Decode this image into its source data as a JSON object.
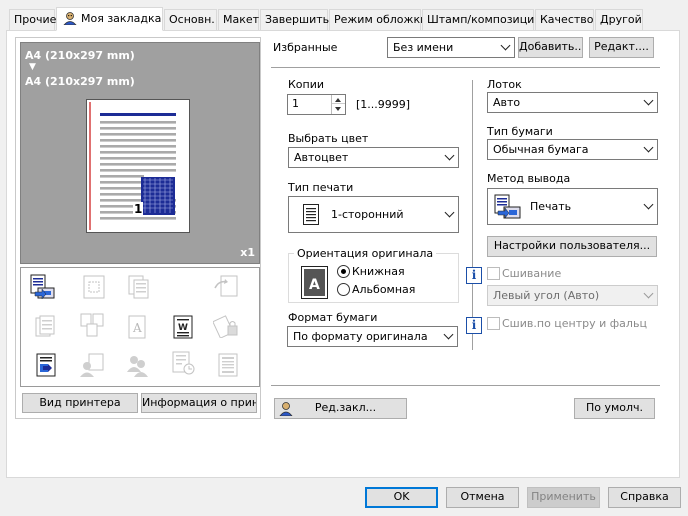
{
  "tabs": [
    {
      "label": "Прочие"
    },
    {
      "label": "Моя закладка"
    },
    {
      "label": "Основн."
    },
    {
      "label": "Макет"
    },
    {
      "label": "Завершить"
    },
    {
      "label": "Режим обложки"
    },
    {
      "label": "Штамп/композиция"
    },
    {
      "label": "Качество"
    },
    {
      "label": "Другой"
    }
  ],
  "preview": {
    "paper_line1": "A4 (210x297 mm)",
    "arrow": "▼",
    "paper_line2": "A4 (210x297 mm)",
    "copies_badge": "x1",
    "page_number": "1"
  },
  "left_buttons": {
    "printer_view": "Вид принтера",
    "printer_info": "Информация о принт."
  },
  "favorites": {
    "label": "Избранные",
    "value": "Без имени",
    "add": "Добавить...",
    "edit": "Редакт...."
  },
  "copies": {
    "label": "Копии",
    "value": "1",
    "range": "[1...9999]"
  },
  "color": {
    "label": "Выбрать цвет",
    "value": "Автоцвет"
  },
  "print_type": {
    "label": "Тип печати",
    "value": "1-сторонний"
  },
  "orientation": {
    "label": "Ориентация оригинала",
    "portrait": "Книжная",
    "landscape": "Альбомная",
    "selected": "portrait"
  },
  "paper_size": {
    "label": "Формат бумаги",
    "value": "По формату оригинала"
  },
  "tray": {
    "label": "Лоток",
    "value": "Авто"
  },
  "paper_type": {
    "label": "Тип бумаги",
    "value": "Обычная бумага"
  },
  "output_method": {
    "label": "Метод вывода",
    "value": "Печать"
  },
  "user_settings": "Настройки пользователя...",
  "staple": {
    "label": "Сшивание",
    "value": "Левый угол (Авто)"
  },
  "center_staple": {
    "label": "Сшив.по центру и фальц"
  },
  "bookmark_edit": "Ред.закл...",
  "defaults": "По умолч.",
  "dialog_buttons": {
    "ok": "OK",
    "cancel": "Отмена",
    "apply": "Применить",
    "help": "Справка"
  },
  "colors": {
    "accent_blue": "#0078d7",
    "preview_bg": "#a0a0a0",
    "doc_blue": "#1d2c96"
  }
}
